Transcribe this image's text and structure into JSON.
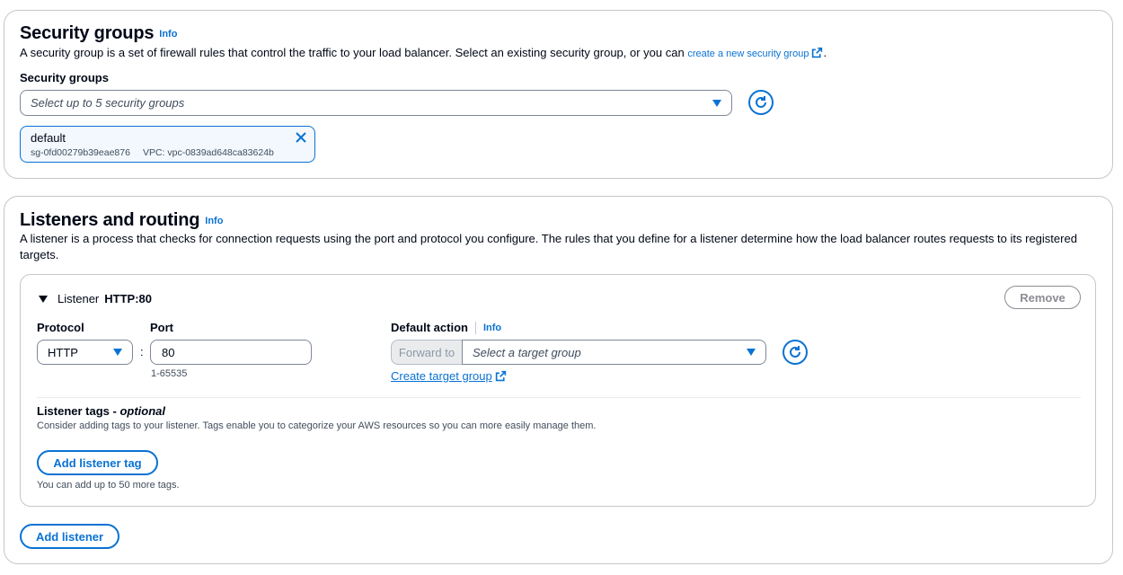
{
  "security_groups": {
    "title": "Security groups",
    "info": "Info",
    "description": "A security group is a set of firewall rules that control the traffic to your load balancer. Select an existing security group, or you can ",
    "create_link": "create a new security group",
    "description_end": ".",
    "field_label": "Security groups",
    "select_placeholder": "Select up to 5 security groups",
    "selected": {
      "name": "default",
      "id": "sg-0fd00279b39eae876",
      "vpc": "VPC: vpc-0839ad648ca83624b"
    }
  },
  "listeners": {
    "title": "Listeners and routing",
    "info": "Info",
    "description": "A listener is a process that checks for connection requests using the port and protocol you configure. The rules that you define for a listener determine how the load balancer routes requests to its registered targets.",
    "listener": {
      "header_prefix": "Listener",
      "header_value": "HTTP:80",
      "remove_label": "Remove",
      "protocol_label": "Protocol",
      "protocol_value": "HTTP",
      "separator": ":",
      "port_label": "Port",
      "port_value": "80",
      "port_hint": "1-65535",
      "default_action_label": "Default action",
      "default_action_info": "Info",
      "forward_to": "Forward to",
      "target_placeholder": "Select a target group",
      "create_target_group": "Create target group",
      "tags_label": "Listener tags - ",
      "tags_optional": "optional",
      "tags_description": "Consider adding tags to your listener. Tags enable you to categorize your AWS resources so you can more easily manage them.",
      "add_tag_button": "Add listener tag",
      "tags_remaining": "You can add up to 50 more tags."
    },
    "add_listener_button": "Add listener"
  },
  "colors": {
    "accent": "#0972d3",
    "border": "#c6c6cd",
    "text": "#000716",
    "muted": "#414d5c"
  }
}
